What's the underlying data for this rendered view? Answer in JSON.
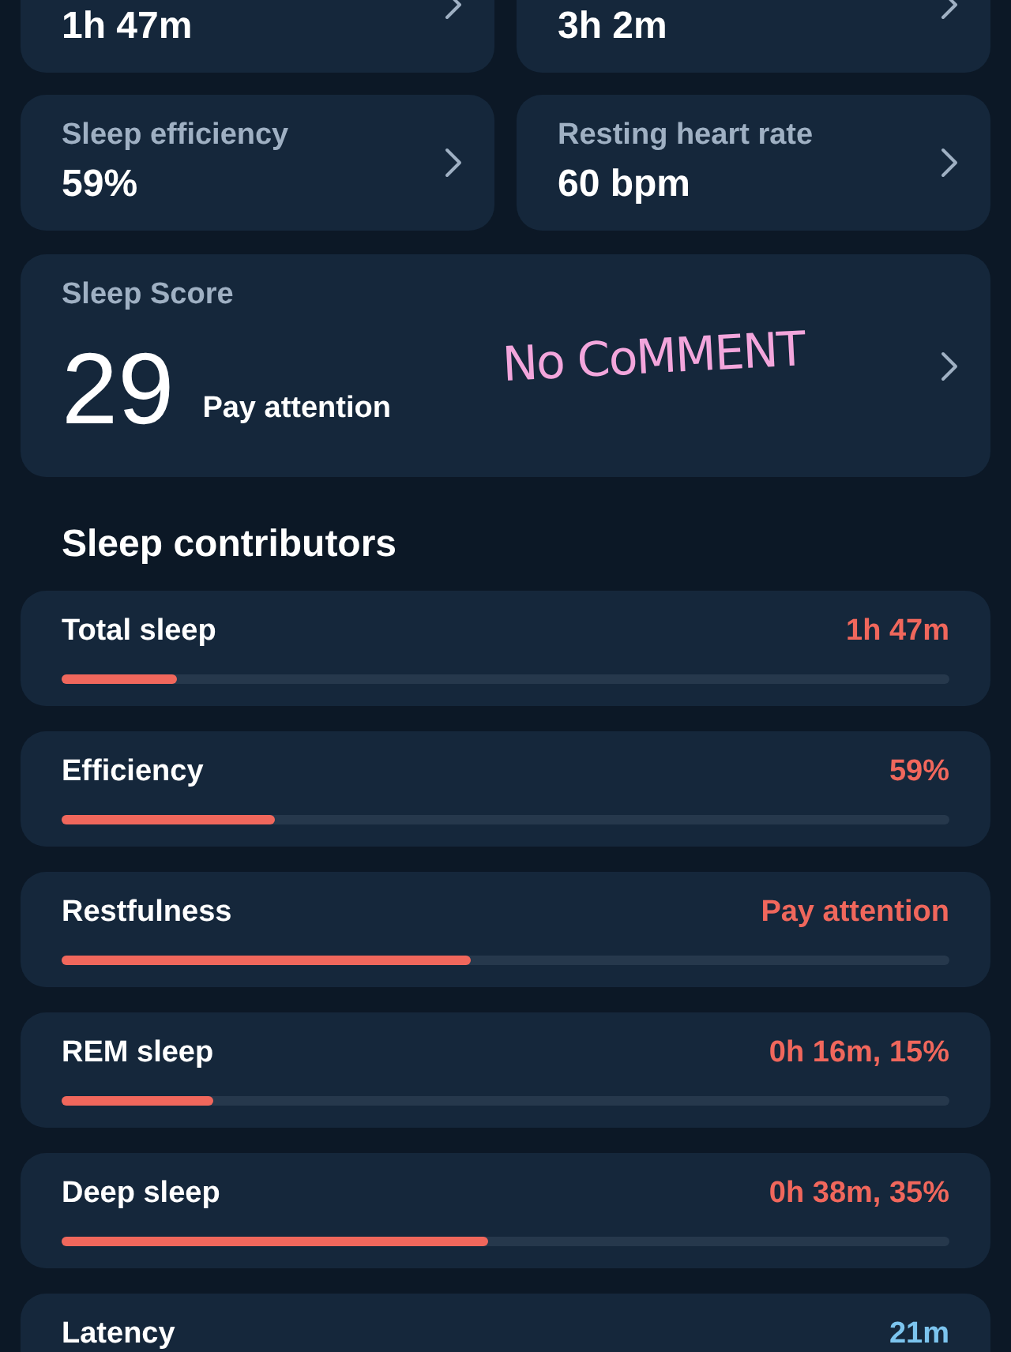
{
  "summary_cards": [
    {
      "value": "1h 47m"
    },
    {
      "value": "3h 2m"
    },
    {
      "label": "Sleep efficiency",
      "value": "59%"
    },
    {
      "label": "Resting heart rate",
      "value": "60 bpm"
    }
  ],
  "sleep_score": {
    "label": "Sleep Score",
    "score": "29",
    "status": "Pay attention",
    "note": "No CoMMENT"
  },
  "contributors_heading": "Sleep contributors",
  "contributors": [
    {
      "name": "Total sleep",
      "value": "1h 47m",
      "color": "#f0675c",
      "level": 0.13
    },
    {
      "name": "Efficiency",
      "value": "59%",
      "color": "#f0675c",
      "level": 0.24
    },
    {
      "name": "Restfulness",
      "value": "Pay attention",
      "color": "#f0675c",
      "level": 0.46
    },
    {
      "name": "REM sleep",
      "value": "0h 16m, 15%",
      "color": "#f0675c",
      "level": 0.17
    },
    {
      "name": "Deep sleep",
      "value": "0h 38m, 35%",
      "color": "#f0675c",
      "level": 0.48
    },
    {
      "name": "Latency",
      "value": "21m",
      "color": "#7cc4ee"
    }
  ]
}
